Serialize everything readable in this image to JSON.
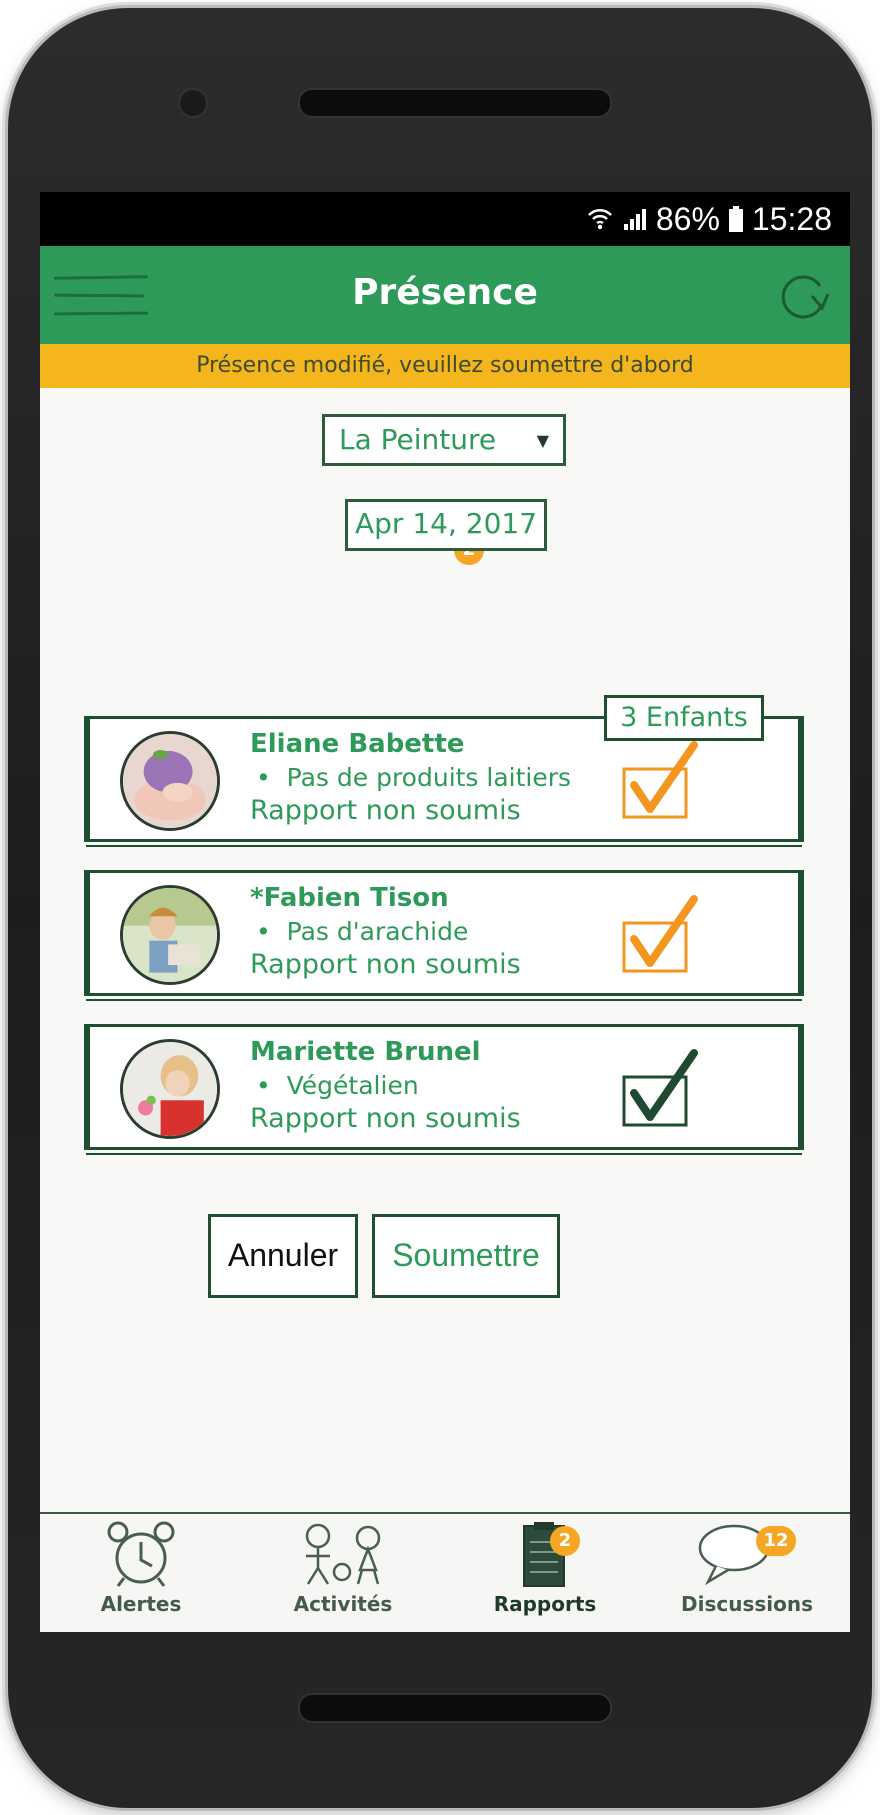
{
  "status_bar": {
    "battery": "86%",
    "time": "15:28"
  },
  "header": {
    "title": "Présence"
  },
  "banner": {
    "text": "Présence modifié, veuillez soumettre d'abord"
  },
  "group_select": {
    "value": "La Peinture",
    "badge": "2"
  },
  "date": {
    "value": "Apr 14, 2017"
  },
  "children_count": "3 Enfants",
  "children": [
    {
      "name": "Eliane Babette",
      "note": "Pas de produits laitiers",
      "status": "Rapport non soumis",
      "checked": true,
      "check_color": "#f2961f"
    },
    {
      "name": "*Fabien Tison",
      "note": "Pas d'arachide",
      "status": "Rapport non soumis",
      "checked": true,
      "check_color": "#f2961f"
    },
    {
      "name": "Mariette Brunel",
      "note": "Végétalien",
      "status": "Rapport non soumis",
      "checked": true,
      "check_color": "#1f4a2f"
    }
  ],
  "actions": {
    "cancel": "Annuler",
    "submit": "Soumettre"
  },
  "tabs": [
    {
      "label": "Alertes",
      "icon": "alarm-clock-icon"
    },
    {
      "label": "Activités",
      "icon": "kids-playing-icon"
    },
    {
      "label": "Rapports",
      "icon": "clipboard-icon",
      "badge": "2",
      "active": true
    },
    {
      "label": "Discussions",
      "icon": "chat-bubble-icon",
      "badge": "12"
    }
  ],
  "colors": {
    "primary": "#2e9a5a",
    "banner": "#f5b51d",
    "accent": "#f2961f",
    "ink": "#1e4f31"
  }
}
